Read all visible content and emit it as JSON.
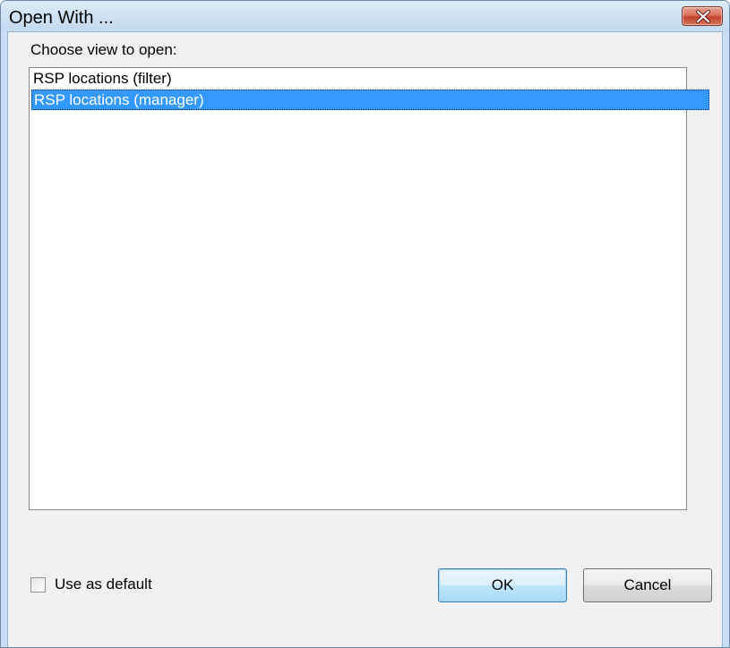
{
  "window": {
    "title": "Open With ..."
  },
  "dialog": {
    "prompt": "Choose view to open:",
    "views": [
      {
        "label": "RSP locations (filter)",
        "selected": false
      },
      {
        "label": "RSP locations (manager)",
        "selected": true
      }
    ],
    "default_checkbox": {
      "label": "Use as default",
      "checked": false
    },
    "ok_label": "OK",
    "cancel_label": "Cancel"
  },
  "icons": {
    "close": "close-icon"
  },
  "colors": {
    "selection": "#3399ff",
    "close_button": "#c2432b"
  }
}
